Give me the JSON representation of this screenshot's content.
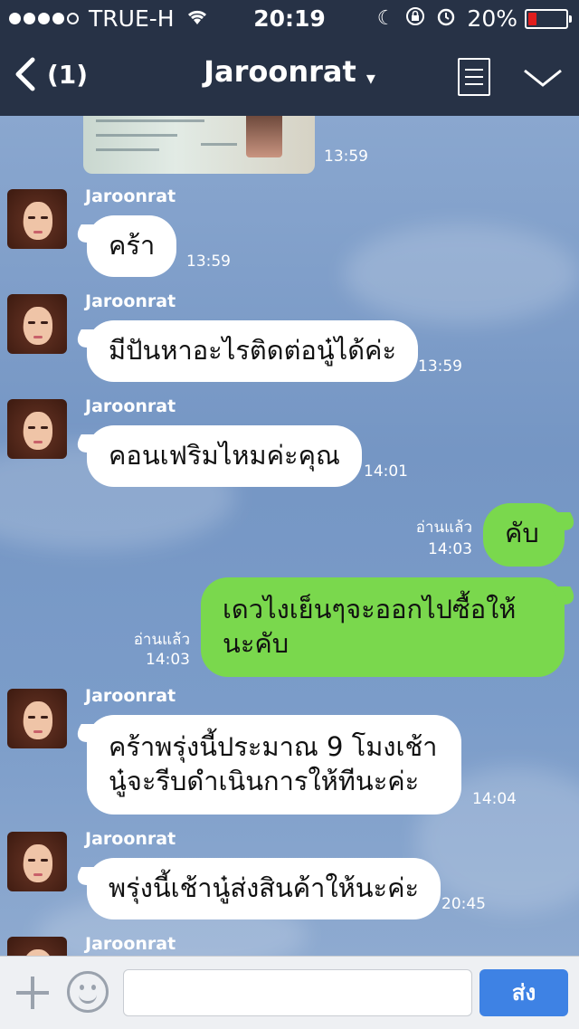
{
  "status_bar": {
    "carrier": "TRUE-H",
    "time": "20:19",
    "battery": "20%",
    "battery_level": 0.2
  },
  "header": {
    "unread_count": "(1)",
    "title": "Jaroonrat",
    "title_caret": "▾"
  },
  "chat": {
    "photo_time": "13:59",
    "messages": [
      {
        "sender": "Jaroonrat",
        "text": "คร้า",
        "time": "13:59"
      },
      {
        "sender": "Jaroonrat",
        "text": "มีปันหาอะไรติดต่อนู๋ได้ค่ะ",
        "time": "13:59"
      },
      {
        "sender": "Jaroonrat",
        "text": "คอนเฟริมไหมค่ะคุณ",
        "time": "14:01"
      },
      {
        "read": "อ่านแล้ว",
        "text": "คับ",
        "time": "14:03"
      },
      {
        "read": "อ่านแล้ว",
        "text": "เดวไงเย็นๆจะออกไปซื้อให้นะคับ",
        "time": "14:03"
      },
      {
        "sender": "Jaroonrat",
        "text": "คร้าพรุ่งนี้ประมาณ 9 โมงเช้านู๋จะรีบดำเนินการให้ทีนะค่ะ",
        "time": "14:04"
      },
      {
        "sender": "Jaroonrat",
        "text": "พรุ่งนี้เช้านู๋ส่งสินค้าให้นะค่ะ",
        "time": "20:45"
      },
      {
        "sender": "Jaroonrat"
      }
    ]
  },
  "input_bar": {
    "placeholder": "",
    "send_label": "ส่ง"
  },
  "colors": {
    "header_bg": "#273246",
    "chat_bg": "#7b9cc7",
    "outgoing_bubble": "#7ad84d",
    "incoming_bubble": "#ffffff",
    "send_button": "#3e82e4",
    "battery_low": "#e01d1d"
  },
  "icons": [
    "signal-dots-icon",
    "wifi-icon",
    "moon-icon",
    "rotation-lock-icon",
    "alarm-icon",
    "battery-icon",
    "back-chevron-icon",
    "caret-down-icon",
    "notes-icon",
    "chevron-down-icon",
    "plus-icon",
    "emoji-icon"
  ]
}
